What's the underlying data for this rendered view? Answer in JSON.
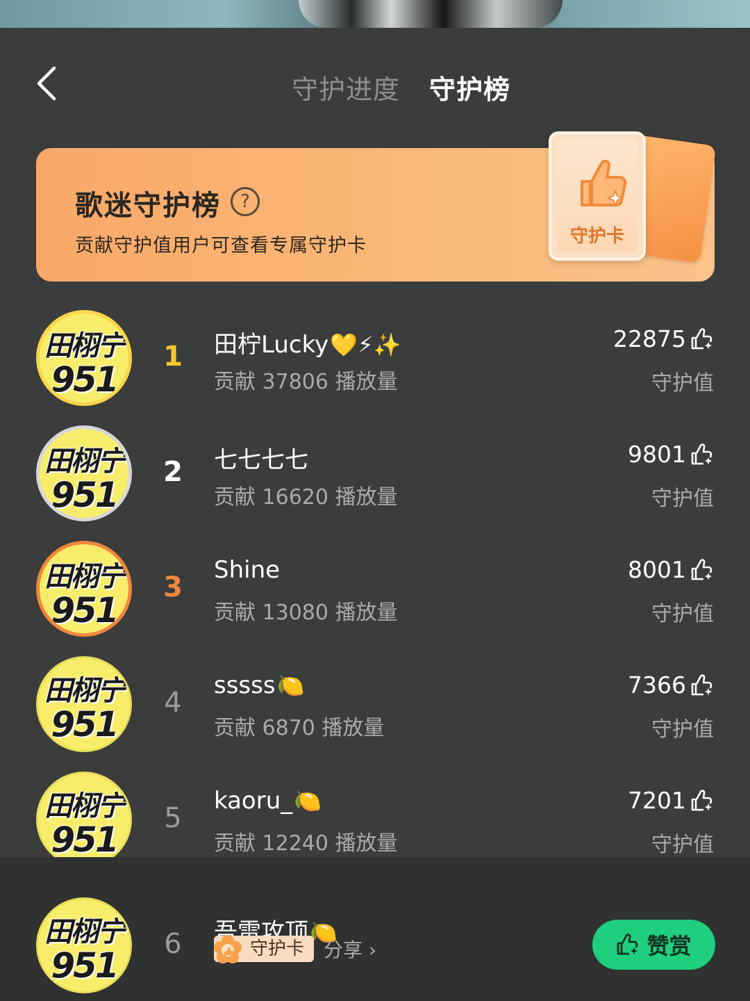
{
  "header": {
    "tabs": [
      {
        "label": "守护进度",
        "active": false
      },
      {
        "label": "守护榜",
        "active": true
      }
    ]
  },
  "banner": {
    "title": "歌迷守护榜",
    "help_symbol": "?",
    "subtitle": "贡献守护值用户可查看专属守护卡",
    "card_label": "守护卡"
  },
  "avatar_text": {
    "line1": "田栩宁",
    "line2": "951"
  },
  "ranking": [
    {
      "rank": "1",
      "name": "田柠Lucky",
      "emoji": "💛⚡✨",
      "contribution": "贡献 37806 播放量",
      "score": "22875",
      "score_label": "守护值"
    },
    {
      "rank": "2",
      "name": "七七七七",
      "emoji": "",
      "contribution": "贡献 16620 播放量",
      "score": "9801",
      "score_label": "守护值"
    },
    {
      "rank": "3",
      "name": "Shine",
      "emoji": "",
      "contribution": "贡献 13080 播放量",
      "score": "8001",
      "score_label": "守护值"
    },
    {
      "rank": "4",
      "name": "sssss",
      "emoji": "🍋",
      "contribution": "贡献 6870 播放量",
      "score": "7366",
      "score_label": "守护值"
    },
    {
      "rank": "5",
      "name": "kaoru_",
      "emoji": "🍋",
      "contribution": "贡献 12240 播放量",
      "score": "7201",
      "score_label": "守护值"
    }
  ],
  "my_rank": {
    "rank": "6",
    "name": "吾雷攻顶",
    "emoji": "🍋",
    "badge_label": "守护卡",
    "share_label": "分享 ›",
    "reward_label": "赞赏"
  },
  "colors": {
    "background": "#3b3c3c",
    "banner_orange": "#fbb878",
    "rank1": "#f7c530",
    "rank3": "#f0873c",
    "reward_green": "#1fcf7d"
  }
}
